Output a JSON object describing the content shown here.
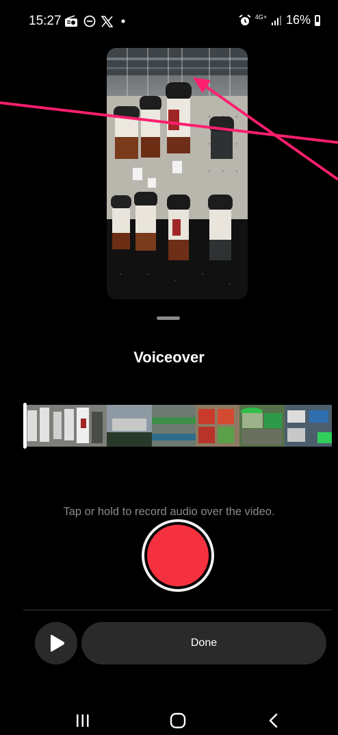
{
  "status_bar": {
    "time": "15:27",
    "left_icons": [
      "radio-icon",
      "dnd-icon",
      "x-logo-icon",
      "notification-dot-icon"
    ],
    "network": "4G+",
    "battery_percent": "16%"
  },
  "preview": {
    "description_icon": "video-preview-thumbnail"
  },
  "sheet": {
    "title": "Voiceover",
    "hint": "Tap or hold to record audio over the video.",
    "done_label": "Done"
  },
  "colors": {
    "record_red": "#f5313f",
    "annotation_arrow": "#ff1f6f",
    "button_bg": "#2a2a2a",
    "hint_text": "#8a8a8a"
  },
  "timeline": {
    "playhead_position": 0
  },
  "nav": {
    "items": [
      "recent-apps-icon",
      "home-icon",
      "back-icon"
    ]
  }
}
